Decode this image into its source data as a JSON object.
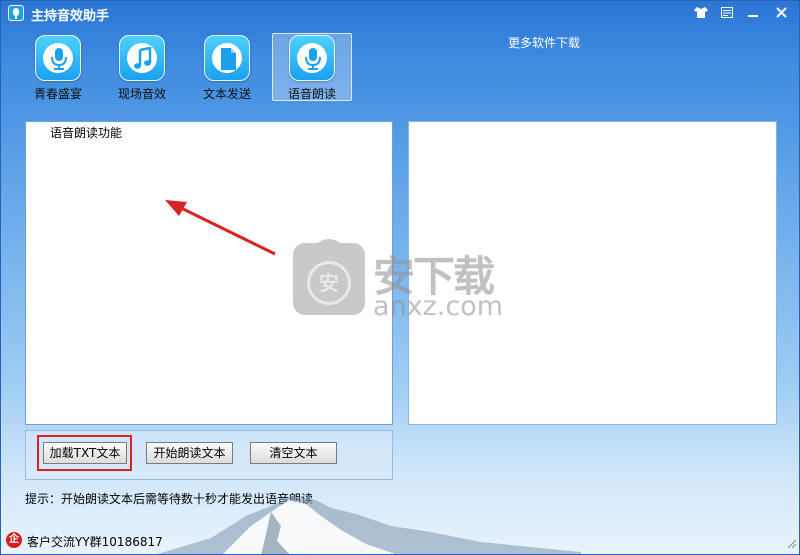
{
  "window": {
    "title": "主持音效助手",
    "controls": [
      "skin-icon",
      "menu-icon",
      "minimize-icon",
      "close-icon"
    ]
  },
  "toolbar": {
    "items": [
      {
        "label": "青春盛宴",
        "icon": "microphone-icon",
        "active": false
      },
      {
        "label": "现场音效",
        "icon": "music-note-icon",
        "active": false
      },
      {
        "label": "文本发送",
        "icon": "document-icon",
        "active": false
      },
      {
        "label": "语音朗读",
        "icon": "microphone-icon",
        "active": true
      }
    ],
    "more_link": "更多软件下载"
  },
  "reader": {
    "text_content": "语音朗读功能",
    "buttons": {
      "load_txt": "加载TXT文本",
      "start_reading": "开始朗读文本",
      "clear_text": "清空文本"
    },
    "hint": "提示：开始朗读文本后需等待数十秒才能发出语音朗读"
  },
  "watermark": {
    "big": "安下载",
    "small": "anxz.com",
    "badge": "安"
  },
  "statusbar": {
    "text": "客户交流YY群10186817",
    "icon_char": "企"
  },
  "colors": {
    "accent": "#2b75d4",
    "annotation": "#d92323"
  }
}
